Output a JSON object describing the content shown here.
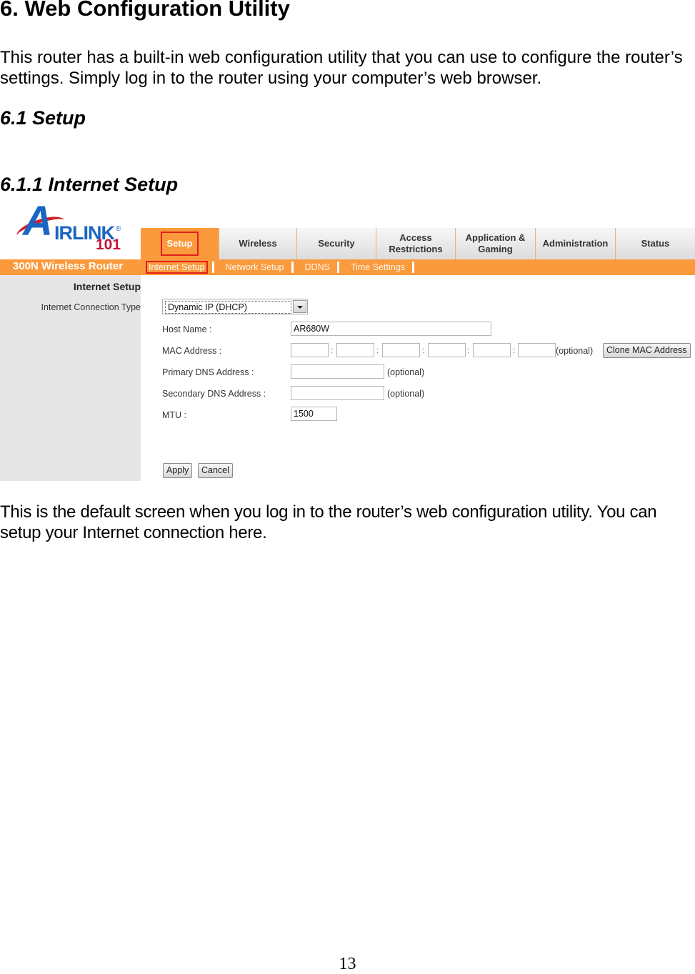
{
  "document": {
    "heading": "6. Web Configuration Utility",
    "intro": "This router has a built-in web configuration utility that you can use to configure the router’s settings. Simply log in to the router using your computer’s web browser.",
    "section": "6.1 Setup",
    "subsection": "6.1.1 Internet Setup",
    "caption": "This is the default screen when you log in to the router’s web configuration utility. You can setup your Internet connection here.",
    "page_number": "13"
  },
  "router_ui": {
    "logo": {
      "letter": "A",
      "wordmark": "IRLINK",
      "registered": "®",
      "number": "101"
    },
    "product_name": "300N Wireless Router",
    "colors": {
      "accent": "#fb9a3d",
      "highlight": "#e0201a",
      "logo_blue": "#1a66c2",
      "logo_red": "#c4143a"
    },
    "tabs": [
      {
        "label": "Setup",
        "active": true
      },
      {
        "label": "Wireless"
      },
      {
        "label": "Security"
      },
      {
        "label": "Access Restrictions"
      },
      {
        "label": "Application & Gaming"
      },
      {
        "label": "Administration"
      },
      {
        "label": "Status"
      }
    ],
    "subtabs": [
      {
        "label": "Internet Setup",
        "active": true
      },
      {
        "label": "Network Setup"
      },
      {
        "label": "DDNS"
      },
      {
        "label": "Time Settings"
      }
    ],
    "left_panel": {
      "title": "Internet Setup",
      "label": "Internet Connection Type"
    },
    "form": {
      "connection_type": "Dynamic IP (DHCP)",
      "host_name_label": "Host Name :",
      "host_name_value": "AR680W",
      "mac_label": "MAC Address :",
      "mac_separator": ":",
      "mac_values": [
        "",
        "",
        "",
        "",
        "",
        ""
      ],
      "optional": "(optional)",
      "clone_mac_button": "Clone MAC Address",
      "primary_dns_label": "Primary DNS Address :",
      "primary_dns_value": "",
      "secondary_dns_label": "Secondary DNS Address :",
      "secondary_dns_value": "",
      "mtu_label": "MTU :",
      "mtu_value": "1500",
      "apply_button": "Apply",
      "cancel_button": "Cancel"
    }
  }
}
